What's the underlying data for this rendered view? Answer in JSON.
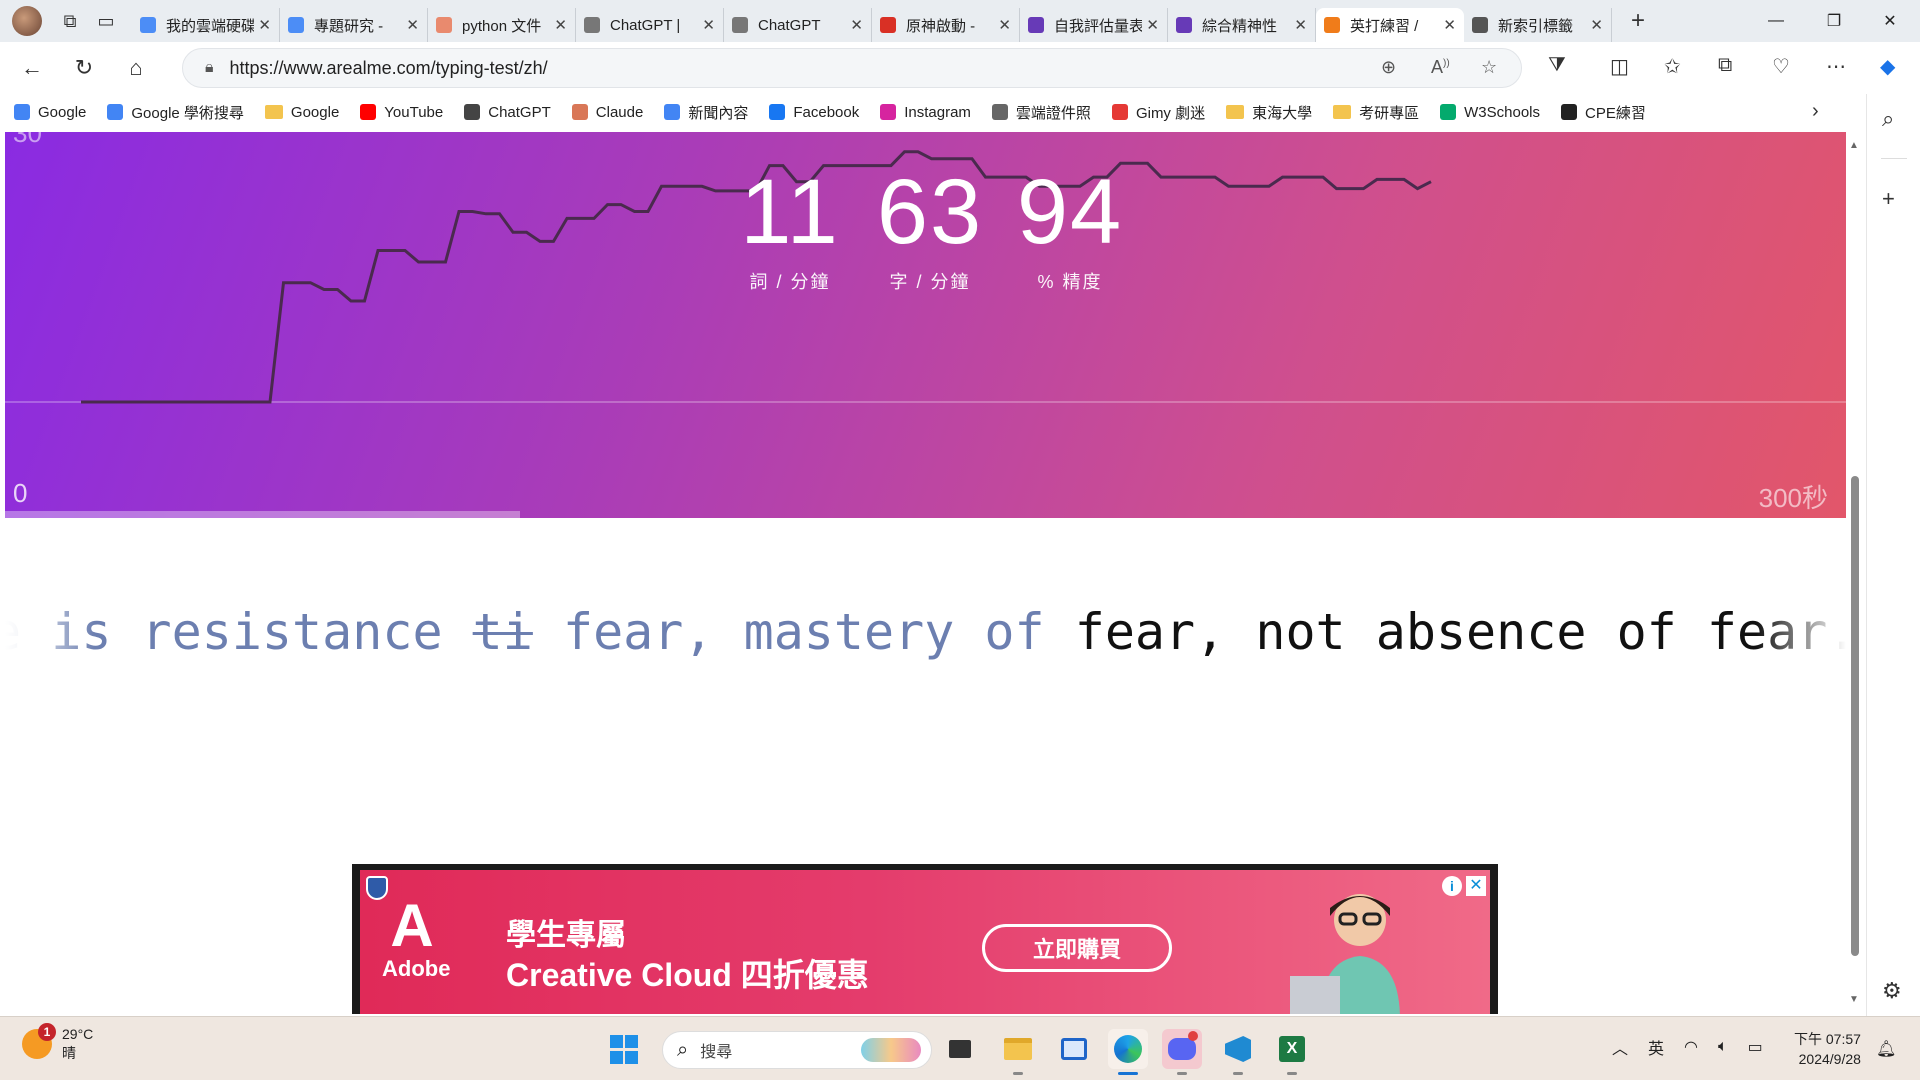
{
  "tabs": [
    {
      "title": "我的雲端硬碟",
      "icon": "google-drive-icon",
      "color": "#4c8df6"
    },
    {
      "title": "專題研究 -",
      "icon": "google-drive-icon",
      "color": "#4c8df6"
    },
    {
      "title": "python 文件",
      "icon": "app-c-icon",
      "color": "#e98a6e"
    },
    {
      "title": "ChatGPT | ",
      "icon": "openai-icon",
      "color": "#777777"
    },
    {
      "title": "ChatGPT",
      "icon": "openai-icon",
      "color": "#777777"
    },
    {
      "title": "原神啟動 -",
      "icon": "bookmark-icon",
      "color": "#d93025"
    },
    {
      "title": "自我評估量表",
      "icon": "forms-icon",
      "color": "#673ab7"
    },
    {
      "title": "綜合精神性",
      "icon": "forms-icon",
      "color": "#673ab7"
    },
    {
      "title": "英打練習 /",
      "icon": "fox-icon",
      "color": "#f07c1a"
    },
    {
      "title": "新索引標籤",
      "icon": "new-tab-icon",
      "color": "#555555"
    }
  ],
  "active_tab_index": 8,
  "url": "https://www.arealme.com/typing-test/zh/",
  "bookmarks": [
    {
      "label": "Google",
      "icon": "google-icon",
      "color": "#4285f4"
    },
    {
      "label": "Google 學術搜尋",
      "icon": "scholar-icon",
      "color": "#4285f4"
    },
    {
      "label": "Google",
      "icon": "folder-icon",
      "color": "#f3c44e"
    },
    {
      "label": "YouTube",
      "icon": "youtube-icon",
      "color": "#ff0000"
    },
    {
      "label": "ChatGPT",
      "icon": "openai-icon",
      "color": "#444444"
    },
    {
      "label": "Claude",
      "icon": "claude-icon",
      "color": "#d97757"
    },
    {
      "label": "新聞內容",
      "icon": "news-icon",
      "color": "#4285f4"
    },
    {
      "label": "Facebook",
      "icon": "facebook-icon",
      "color": "#1877f2"
    },
    {
      "label": "Instagram",
      "icon": "instagram-icon",
      "color": "#d6249f"
    },
    {
      "label": "雲端證件照",
      "icon": "document-icon",
      "color": "#666666"
    },
    {
      "label": "Gimy 劇迷",
      "icon": "gimy-icon",
      "color": "#e53935"
    },
    {
      "label": "東海大學",
      "icon": "folder-icon",
      "color": "#f3c44e"
    },
    {
      "label": "考研專區",
      "icon": "folder-icon",
      "color": "#f3c44e"
    },
    {
      "label": "W3Schools",
      "icon": "w3schools-icon",
      "color": "#04aa6d"
    },
    {
      "label": "CPE練習",
      "icon": "github-icon",
      "color": "#222222"
    }
  ],
  "stats": {
    "wpm": "11",
    "wpm_label": "詞 / 分鐘",
    "cpm": "63",
    "cpm_label": "字 / 分鐘",
    "acc": "94",
    "acc_label": "% 精度"
  },
  "chart_data": {
    "type": "line",
    "title": "",
    "y_axis_max_label": "30",
    "x_axis_start_label": "0",
    "x_axis_end_label": "300秒",
    "xlim": [
      0,
      300
    ],
    "elapsed_fraction": 0.28,
    "series": [
      {
        "x": [
          0,
          62
        ],
        "y": [
          0,
          0
        ]
      }
    ],
    "line_points": [
      [
        0,
        0
      ],
      [
        14,
        0
      ],
      [
        15,
        5.2
      ],
      [
        17,
        5.2
      ],
      [
        18,
        4.9
      ],
      [
        19,
        4.9
      ],
      [
        20,
        4.4
      ],
      [
        21,
        4.4
      ],
      [
        22,
        6.6
      ],
      [
        24,
        6.6
      ],
      [
        25,
        6.1
      ],
      [
        27,
        6.1
      ],
      [
        28,
        8.3
      ],
      [
        29,
        8.3
      ],
      [
        30,
        8.2
      ],
      [
        31,
        8.2
      ],
      [
        32,
        7.4
      ],
      [
        33,
        7.4
      ],
      [
        34,
        7.0
      ],
      [
        35,
        7.0
      ],
      [
        36,
        8.0
      ],
      [
        38,
        8.0
      ],
      [
        39,
        8.6
      ],
      [
        40,
        8.6
      ],
      [
        41,
        8.3
      ],
      [
        42,
        8.3
      ],
      [
        43,
        9.4
      ],
      [
        46,
        9.4
      ],
      [
        47,
        9.2
      ],
      [
        50,
        9.2
      ],
      [
        51,
        10.3
      ],
      [
        52,
        10.3
      ],
      [
        53,
        9.6
      ],
      [
        54,
        9.6
      ],
      [
        55,
        10.3
      ],
      [
        60,
        10.3
      ],
      [
        61,
        10.9
      ],
      [
        62,
        10.9
      ],
      [
        63,
        10.6
      ],
      [
        66,
        10.6
      ],
      [
        67,
        9.8
      ],
      [
        70,
        9.8
      ],
      [
        71,
        9.4
      ],
      [
        74,
        9.4
      ],
      [
        75,
        9.8
      ],
      [
        76,
        9.8
      ],
      [
        77,
        10.4
      ],
      [
        79,
        10.4
      ],
      [
        80,
        9.8
      ],
      [
        84,
        9.8
      ],
      [
        85,
        9.4
      ],
      [
        88,
        9.4
      ],
      [
        89,
        9.8
      ],
      [
        92,
        9.8
      ],
      [
        93,
        9.3
      ],
      [
        95,
        9.3
      ],
      [
        96,
        9.7
      ],
      [
        98,
        9.7
      ],
      [
        99,
        9.3
      ],
      [
        100,
        9.6
      ]
    ],
    "ylim": [
      0,
      30
    ]
  },
  "typing_text": {
    "leading": "e ",
    "typed_before": "is resistance ",
    "error_word": "ti",
    "typed_after": " fear, mastery of",
    "pending": " fear, not absence of fear. It's not"
  },
  "ad": {
    "brand": "Adobe",
    "headline": "學生專屬",
    "subheadline": "Creative Cloud 四折優惠",
    "cta": "立即購買"
  },
  "taskbar": {
    "temperature": "29°C",
    "weather": "晴",
    "notification_count": "1",
    "search_placeholder": "搜尋",
    "ime": "英",
    "time": "下午 07:57",
    "date": "2024/9/28"
  }
}
